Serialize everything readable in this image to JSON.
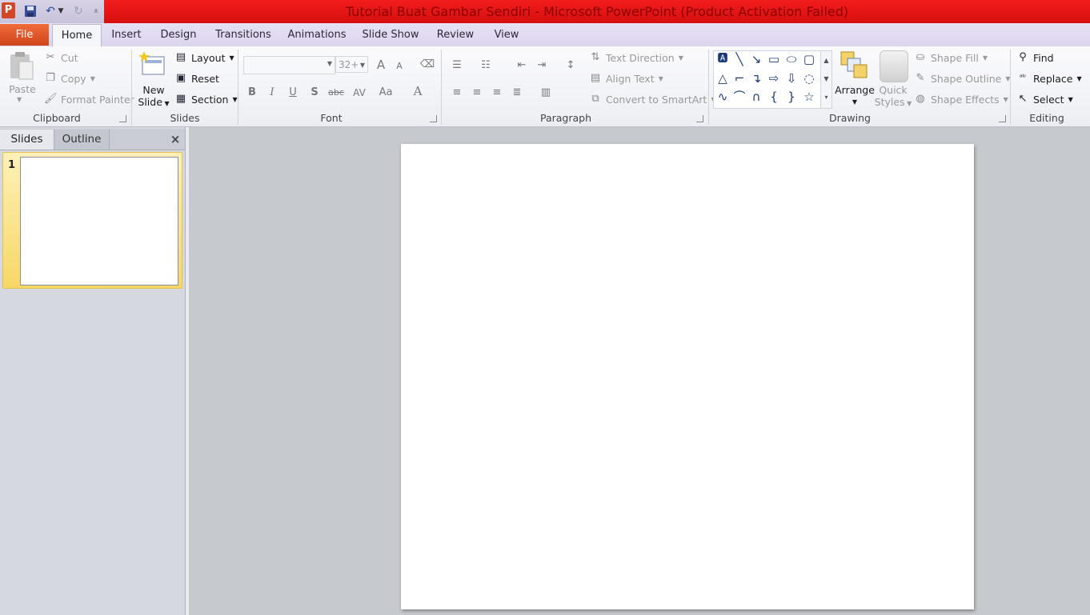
{
  "window": {
    "title": "Tutorial Buat Gambar Sendiri  -  Microsoft PowerPoint (Product Activation Failed)",
    "app_logo_letter": "P"
  },
  "qat": {
    "save": "save-icon",
    "undo": "undo-icon",
    "redo": "redo-icon",
    "customize": "customize-icon"
  },
  "tabs": [
    "File",
    "Home",
    "Insert",
    "Design",
    "Transitions",
    "Animations",
    "Slide Show",
    "Review",
    "View"
  ],
  "ribbon": {
    "clipboard": {
      "label": "Clipboard",
      "paste": "Paste",
      "cut": "Cut",
      "copy": "Copy",
      "format_painter": "Format Painter"
    },
    "slides": {
      "label": "Slides",
      "new_slide_line1": "New",
      "new_slide_line2": "Slide",
      "layout": "Layout",
      "reset": "Reset",
      "section": "Section"
    },
    "font": {
      "label": "Font",
      "font_name": "",
      "font_size": "32+",
      "bold": "B",
      "italic": "I",
      "underline": "U",
      "shadow": "S",
      "strike": "abc",
      "spacing": "AV",
      "case": "Aa",
      "color": "A",
      "grow": "A",
      "shrink": "A"
    },
    "paragraph": {
      "label": "Paragraph",
      "text_direction": "Text Direction",
      "align_text": "Align Text",
      "convert_smartart": "Convert to SmartArt"
    },
    "drawing": {
      "label": "Drawing",
      "arrange": "Arrange",
      "quick_styles_line1": "Quick",
      "quick_styles_line2": "Styles",
      "shape_fill": "Shape Fill",
      "shape_outline": "Shape Outline",
      "shape_effects": "Shape Effects"
    },
    "editing": {
      "label": "Editing",
      "find": "Find",
      "replace": "Replace",
      "select": "Select"
    }
  },
  "panel": {
    "tab_slides": "Slides",
    "tab_outline": "Outline",
    "close": "×",
    "thumbnails": [
      {
        "number": "1"
      }
    ]
  },
  "colors": {
    "title_bar": "#e31414",
    "file_tab": "#d9532a",
    "selected_thumb": "#f7d766"
  }
}
